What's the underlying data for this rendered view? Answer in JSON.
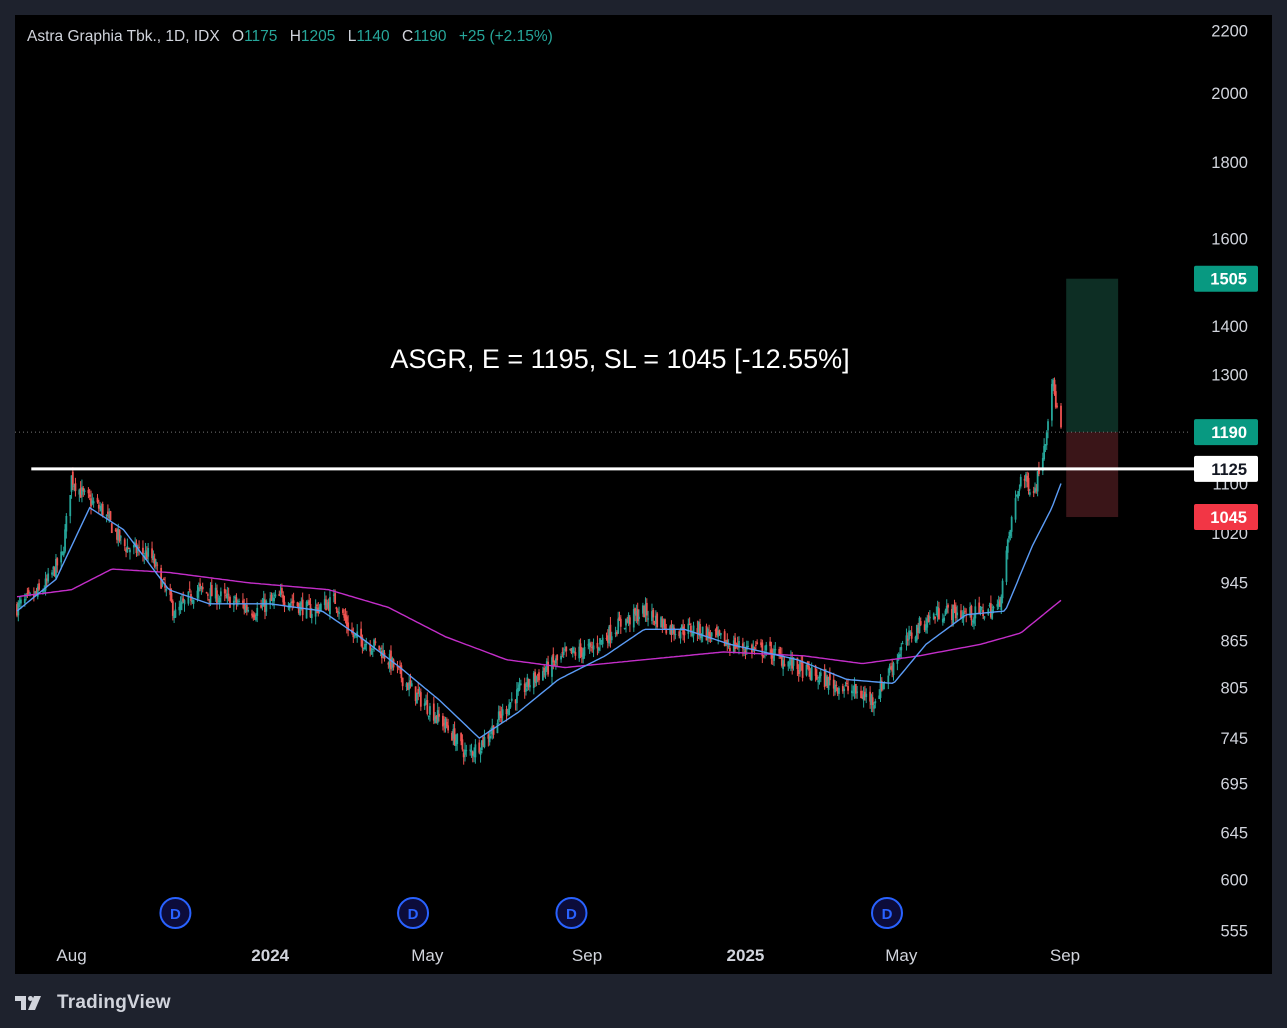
{
  "legend": {
    "symbol": "Astra Graphia Tbk., 1D, IDX",
    "o_label": "O",
    "o_value": "1175",
    "h_label": "H",
    "h_value": "1205",
    "l_label": "L",
    "l_value": "1140",
    "c_label": "C",
    "c_value": "1190",
    "change": "+25 (+2.15%)"
  },
  "annotation": "ASGR, E = 1195, SL = 1045 [-12.55%]",
  "footer": {
    "brand": "TradingView"
  },
  "colors": {
    "background": "#000000",
    "frame": "#1e222d",
    "up": "#26a69a",
    "down": "#ef5350",
    "ma_fast": "#5b9cf6",
    "ma_slow": "#c32ec9",
    "target_zone": "#0d2e24",
    "stop_zone": "#3a1518",
    "target_tag": "#089981",
    "stop_tag": "#f23645",
    "dividend": "#2962ff"
  },
  "chart_data": {
    "type": "candlestick",
    "scale": "log",
    "ylim": [
      520,
      2250
    ],
    "y_ticks": [
      2200,
      2000,
      1800,
      1600,
      1400,
      1300,
      1100,
      1020,
      945,
      865,
      805,
      745,
      695,
      645,
      600,
      555
    ],
    "x_labels": [
      "Aug",
      "2024",
      "May",
      "Sep",
      "2025",
      "May",
      "Sep"
    ],
    "x_labels_bold": [
      false,
      true,
      false,
      false,
      true,
      false,
      false
    ],
    "x_range": [
      "2023-06",
      "2025-09"
    ],
    "price_path": [
      [
        "2023-06-20",
        910
      ],
      [
        "2023-07-10",
        935
      ],
      [
        "2023-07-25",
        985
      ],
      [
        "2023-08-01",
        1110
      ],
      [
        "2023-08-10",
        1080
      ],
      [
        "2023-08-25",
        1055
      ],
      [
        "2023-09-10",
        1000
      ],
      [
        "2023-10-01",
        985
      ],
      [
        "2023-10-20",
        900
      ],
      [
        "2023-11-05",
        935
      ],
      [
        "2023-12-01",
        920
      ],
      [
        "2023-12-20",
        905
      ],
      [
        "2024-01-10",
        925
      ],
      [
        "2024-02-01",
        905
      ],
      [
        "2024-02-20",
        920
      ],
      [
        "2024-03-05",
        870
      ],
      [
        "2024-03-25",
        855
      ],
      [
        "2024-04-20",
        800
      ],
      [
        "2024-05-15",
        760
      ],
      [
        "2024-06-01",
        725
      ],
      [
        "2024-06-15",
        745
      ],
      [
        "2024-07-05",
        790
      ],
      [
        "2024-07-25",
        820
      ],
      [
        "2024-08-15",
        845
      ],
      [
        "2024-09-05",
        855
      ],
      [
        "2024-09-25",
        885
      ],
      [
        "2024-10-15",
        905
      ],
      [
        "2024-11-05",
        880
      ],
      [
        "2024-11-25",
        880
      ],
      [
        "2024-12-20",
        860
      ],
      [
        "2025-01-20",
        850
      ],
      [
        "2025-02-10",
        830
      ],
      [
        "2025-03-01",
        815
      ],
      [
        "2025-03-25",
        800
      ],
      [
        "2025-04-10",
        790
      ],
      [
        "2025-05-01",
        855
      ],
      [
        "2025-05-15",
        885
      ],
      [
        "2025-06-01",
        905
      ],
      [
        "2025-06-25",
        900
      ],
      [
        "2025-07-15",
        910
      ],
      [
        "2025-07-25",
        1040
      ],
      [
        "2025-08-01",
        1110
      ],
      [
        "2025-08-12",
        1090
      ],
      [
        "2025-08-20",
        1180
      ],
      [
        "2025-08-25",
        1290
      ],
      [
        "2025-09-01",
        1190
      ]
    ],
    "ma_fast_path": [
      [
        "2023-06-20",
        905
      ],
      [
        "2023-07-20",
        950
      ],
      [
        "2023-08-15",
        1060
      ],
      [
        "2023-09-10",
        1025
      ],
      [
        "2023-10-15",
        935
      ],
      [
        "2023-11-15",
        915
      ],
      [
        "2024-01-01",
        915
      ],
      [
        "2024-02-10",
        905
      ],
      [
        "2024-03-10",
        870
      ],
      [
        "2024-04-10",
        830
      ],
      [
        "2024-05-10",
        790
      ],
      [
        "2024-06-10",
        745
      ],
      [
        "2024-07-10",
        775
      ],
      [
        "2024-08-10",
        815
      ],
      [
        "2024-09-15",
        845
      ],
      [
        "2024-10-15",
        880
      ],
      [
        "2024-11-15",
        880
      ],
      [
        "2024-12-20",
        860
      ],
      [
        "2025-02-10",
        840
      ],
      [
        "2025-03-20",
        815
      ],
      [
        "2025-04-25",
        810
      ],
      [
        "2025-05-20",
        860
      ],
      [
        "2025-06-20",
        900
      ],
      [
        "2025-07-20",
        905
      ],
      [
        "2025-08-10",
        1000
      ],
      [
        "2025-08-25",
        1060
      ],
      [
        "2025-09-01",
        1100
      ]
    ],
    "ma_slow_path": [
      [
        "2023-06-20",
        925
      ],
      [
        "2023-08-01",
        935
      ],
      [
        "2023-09-01",
        965
      ],
      [
        "2023-10-15",
        960
      ],
      [
        "2023-12-15",
        945
      ],
      [
        "2024-02-15",
        935
      ],
      [
        "2024-04-01",
        910
      ],
      [
        "2024-05-15",
        870
      ],
      [
        "2024-07-01",
        840
      ],
      [
        "2024-08-15",
        830
      ],
      [
        "2024-10-15",
        840
      ],
      [
        "2024-12-15",
        850
      ],
      [
        "2025-02-15",
        845
      ],
      [
        "2025-04-01",
        835
      ],
      [
        "2025-05-15",
        845
      ],
      [
        "2025-07-01",
        860
      ],
      [
        "2025-08-01",
        875
      ],
      [
        "2025-09-01",
        920
      ]
    ],
    "horizontal_line": {
      "price": 1125,
      "label": "1125"
    },
    "last_price_line": 1190,
    "position": {
      "entry": 1190,
      "target": 1505,
      "stop": 1045,
      "start": "2025-09-05",
      "end": "2025-10-15"
    },
    "price_tags": [
      {
        "id": "target",
        "value": "1505"
      },
      {
        "id": "close",
        "value": "1190"
      },
      {
        "id": "level",
        "value": "1125"
      },
      {
        "id": "stop",
        "value": "1045"
      }
    ],
    "dividend_markers": [
      "2023-10-20",
      "2024-04-20",
      "2024-08-20",
      "2025-04-20"
    ],
    "dividend_label": "D"
  }
}
